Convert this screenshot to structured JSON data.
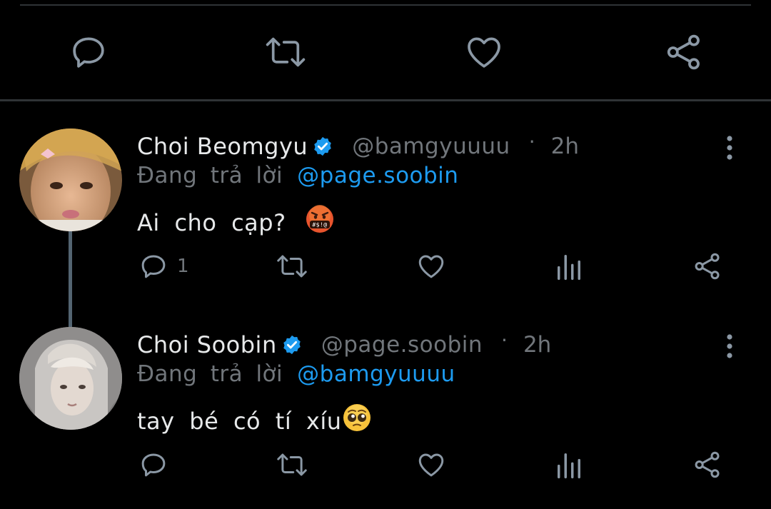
{
  "top_actions": [
    "reply-icon",
    "retweet-icon",
    "like-icon",
    "share-icon"
  ],
  "tweets": [
    {
      "name": "Choi Beomgyu",
      "handle": "@bamgyuuuu",
      "separator": "·",
      "time": "2h",
      "replying_label": "Đang trả lời",
      "replying_to": "@page.soobin",
      "text": "Ai cho cạp?",
      "emoji": "face-with-symbols-on-mouth",
      "reply_count": "1"
    },
    {
      "name": "Choi Soobin",
      "handle": "@page.soobin",
      "separator": "·",
      "time": "2h",
      "replying_label": "Đang trả lời",
      "replying_to": "@bamgyuuuu",
      "text": "tay bé có tí xíu",
      "emoji": "pleading-face",
      "reply_count": ""
    }
  ],
  "colors": {
    "background": "#000000",
    "text": "#e7e9ea",
    "muted": "#71767b",
    "accent": "#1d9bf0",
    "divider": "#2f3336"
  }
}
